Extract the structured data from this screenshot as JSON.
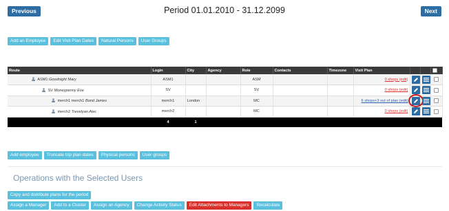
{
  "header": {
    "previous_label": "Previous",
    "next_label": "Next",
    "title": "Period 01.01.2010 - 31.12.2099"
  },
  "top_buttons": [
    "Add an Employee",
    "Edit Visit Plan Dates",
    "Natural Persons",
    "User Groups"
  ],
  "table": {
    "columns": [
      "Route",
      "Login",
      "City",
      "Agency",
      "Role",
      "Contacts",
      "Timezone",
      "Visit Plan"
    ],
    "rows": [
      {
        "route_name": "ASM1",
        "route_person": "Goodnight Mary",
        "login": "ASM1",
        "city": "",
        "agency": "",
        "role": "ASM",
        "contacts": "",
        "timezone": "",
        "visit_plan": "0 shops (edit)"
      },
      {
        "route_name": "SV",
        "route_person": "Moneypenny Eve",
        "login": "SV",
        "city": "",
        "agency": "",
        "role": "SV",
        "contacts": "",
        "timezone": "",
        "visit_plan": "0 shops (edit)"
      },
      {
        "route_name": "merch1 merch1",
        "route_person": "Bond James",
        "login": "merch1",
        "city": "London",
        "agency": "",
        "role": "MC",
        "contacts": "",
        "timezone": "",
        "visit_plan": "6 shops+3 out of plan (edit)"
      },
      {
        "route_name": "merch2",
        "route_person": "Trevelyan Alec",
        "login": "merch2",
        "city": "",
        "agency": "",
        "role": "MC",
        "contacts": "",
        "timezone": "",
        "visit_plan": "0 shops (edit)"
      }
    ],
    "totals": {
      "login": "4",
      "city": "1"
    }
  },
  "bottom_buttons": [
    "Add employee",
    "Truncate trip plan dates",
    "Physical persons",
    "User groups"
  ],
  "operations": {
    "title": "Operations with the Selected Users",
    "copy_label": "Copy and distribute plans for the period",
    "buttons": [
      "Assign a Manager",
      "Add to a Cluster",
      "Assign an Agency",
      "Change Activity Status",
      "Edit Attachments to Managers",
      "Recalculate"
    ]
  },
  "colors": {
    "primary": "#2e6da4",
    "light_button": "#5bc0de",
    "danger": "#d9302c",
    "highlight_ring": "#c81e1e"
  },
  "icons": {
    "edit": "pencil-icon",
    "list": "list-icon",
    "user": "user-icon"
  }
}
